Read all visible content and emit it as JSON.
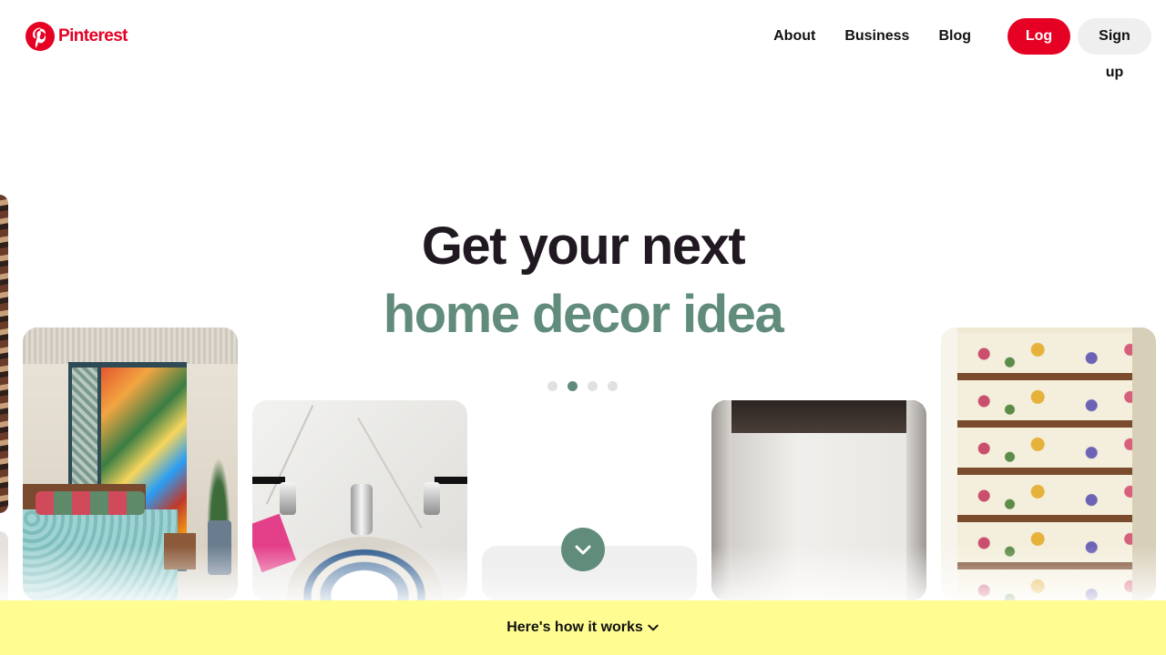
{
  "header": {
    "brand_name": "Pinterest",
    "nav": {
      "about": "About",
      "business": "Business",
      "blog": "Blog"
    },
    "login_label": "Log in",
    "signup_label": "Sign up"
  },
  "hero": {
    "headline": "Get your next",
    "subheadline": "home decor idea",
    "carousel_active_index": 2,
    "carousel_total": 4
  },
  "banner": {
    "label": "Here's how it works"
  },
  "colors": {
    "brand_red": "#e60023",
    "accent_green": "#618c7b",
    "banner_yellow": "#fffd92",
    "headline_dark": "#211922"
  },
  "icons": {
    "logo": "pinterest-logo-icon",
    "scroll_down": "chevron-down-icon",
    "banner_arrow": "chevron-down-icon"
  }
}
